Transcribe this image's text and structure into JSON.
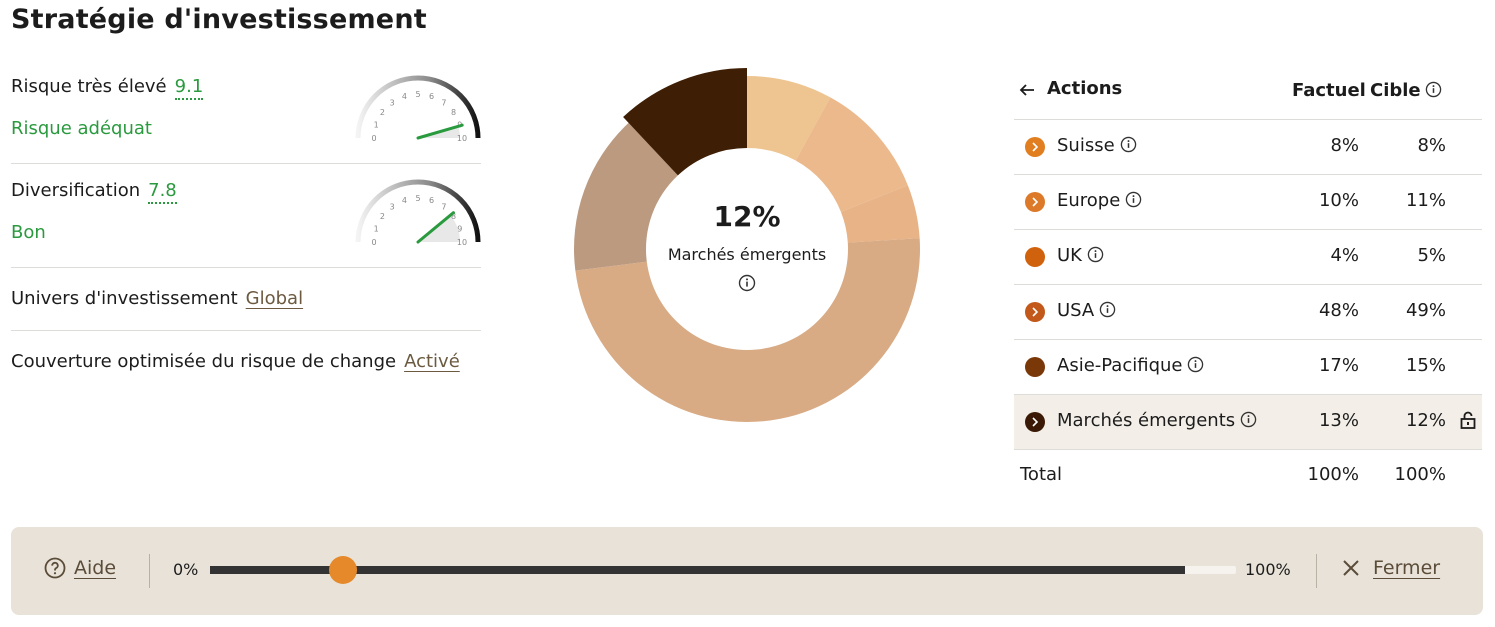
{
  "page": {
    "title": "Stratégie d'investissement"
  },
  "metrics": {
    "risk": {
      "label": "Risque très élevé",
      "value": "9.1",
      "sub": "Risque adéquat",
      "gauge_value": 9.1
    },
    "diversification": {
      "label": "Diversification",
      "value": "7.8",
      "sub": "Bon",
      "gauge_value": 7.8
    },
    "gauge_ticks": [
      "0",
      "1",
      "2",
      "3",
      "4",
      "5",
      "6",
      "7",
      "8",
      "9",
      "10"
    ],
    "universe": {
      "label": "Univers d'investissement",
      "value": "Global"
    },
    "hedge": {
      "label": "Couverture optimisée du risque de change",
      "value": "Activé"
    }
  },
  "donut": {
    "center_value": "12%",
    "center_label": "Marchés émergents",
    "segments": [
      {
        "name": "Suisse",
        "value": 8,
        "color": "#eec590"
      },
      {
        "name": "Europe",
        "value": 11,
        "color": "#ebb98c"
      },
      {
        "name": "UK",
        "value": 5,
        "color": "#e8b387"
      },
      {
        "name": "USA",
        "value": 49,
        "color": "#d8ab85"
      },
      {
        "name": "Asie-Pacifique",
        "value": 15,
        "color": "#bb9a80"
      },
      {
        "name": "Marchés émergents",
        "value": 12,
        "color": "#3e1e04"
      }
    ]
  },
  "table": {
    "category": "Actions",
    "col_actual": "Factuel",
    "col_target": "Cible",
    "rows": [
      {
        "label": "Suisse",
        "actual": "8%",
        "target": "8%",
        "color": "#e07e20",
        "chevron": true
      },
      {
        "label": "Europe",
        "actual": "10%",
        "target": "11%",
        "color": "#dc7a2a",
        "chevron": true
      },
      {
        "label": "UK",
        "actual": "4%",
        "target": "5%",
        "color": "#d0620e",
        "chevron": false
      },
      {
        "label": "USA",
        "actual": "48%",
        "target": "49%",
        "color": "#c2581a",
        "chevron": true
      },
      {
        "label": "Asie-Pacifique",
        "actual": "17%",
        "target": "15%",
        "color": "#7a3808",
        "chevron": false
      },
      {
        "label": "Marchés émergents",
        "actual": "13%",
        "target": "12%",
        "color": "#3a1a06",
        "chevron": true
      }
    ],
    "total": {
      "label": "Total",
      "actual": "100%",
      "target": "100%"
    }
  },
  "bottom_bar": {
    "help_label": "Aide",
    "min_label": "0%",
    "max_label": "100%",
    "slider_value": 13,
    "close_label": "Fermer",
    "accent": "#e5892a"
  }
}
